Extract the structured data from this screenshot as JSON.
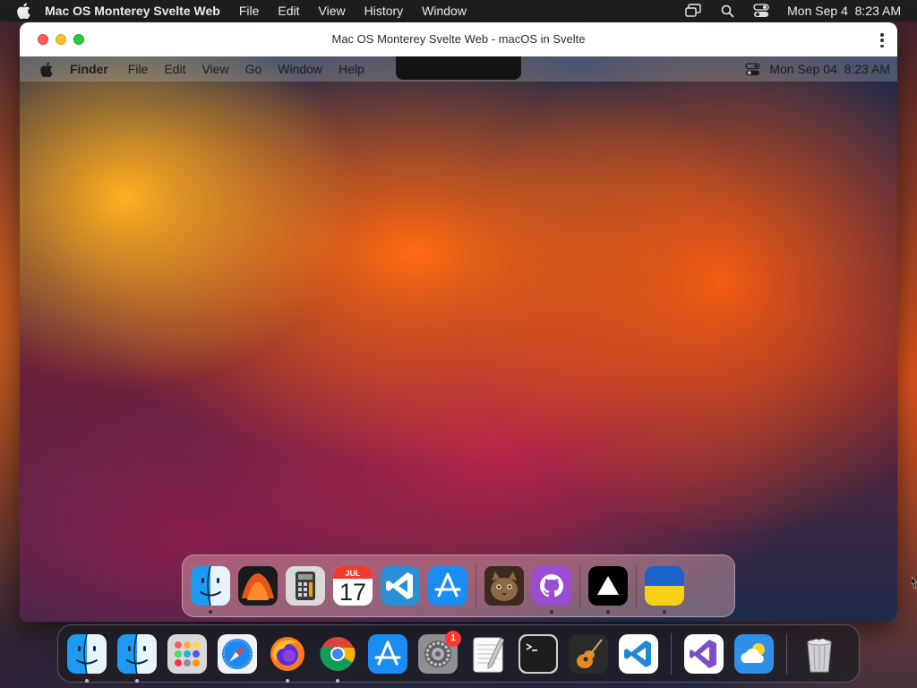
{
  "host_menubar": {
    "app_name": "Mac OS Monterey Svelte Web",
    "items": [
      "File",
      "Edit",
      "View",
      "History",
      "Window"
    ],
    "datetime": "Mon Sep 4  8:23 AM"
  },
  "window": {
    "title": "Mac OS Monterey Svelte Web - macOS in Svelte"
  },
  "inner_menubar": {
    "app_name": "Finder",
    "items": [
      "File",
      "Edit",
      "View",
      "Go",
      "Window",
      "Help"
    ],
    "datetime": "Mon Sep 04  8:23 AM"
  },
  "inner_dock": {
    "calendar_month": "JUL",
    "calendar_day": "17"
  },
  "host_dock": {
    "settings_badge": "1"
  },
  "colors": {
    "traffic_close": "#fe5f57",
    "traffic_minimize": "#febc2e",
    "traffic_maximize": "#28c840",
    "badge": "#ff3b30"
  }
}
